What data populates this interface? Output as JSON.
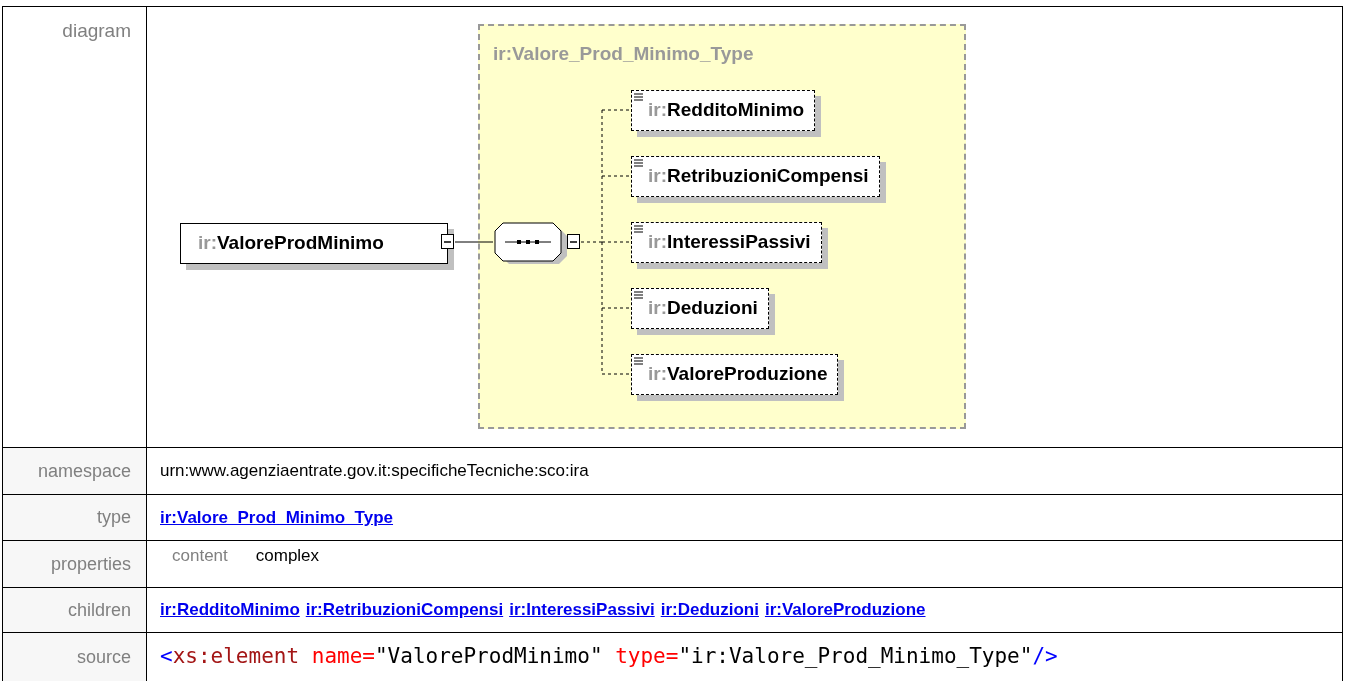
{
  "diagram": {
    "label": "diagram",
    "type_title": "ir:Valore_Prod_Minimo_Type",
    "element": {
      "prefix": "ir:",
      "name": "ValoreProdMinimo"
    },
    "children": [
      {
        "prefix": "ir:",
        "name": "RedditoMinimo"
      },
      {
        "prefix": "ir:",
        "name": "RetribuzioniCompensi"
      },
      {
        "prefix": "ir:",
        "name": "InteressiPassivi"
      },
      {
        "prefix": "ir:",
        "name": "Deduzioni"
      },
      {
        "prefix": "ir:",
        "name": "ValoreProduzione"
      }
    ]
  },
  "rows": [
    {
      "kind": "text",
      "label": "namespace",
      "value": "urn:www.agenziaentrate.gov.it:specificheTecniche:sco:ira"
    },
    {
      "kind": "link",
      "label": "type",
      "value": "ir:Valore_Prod_Minimo_Type"
    },
    {
      "kind": "properties",
      "label": "properties",
      "key": "content",
      "value": "complex"
    },
    {
      "kind": "links",
      "label": "children",
      "links": [
        "ir:RedditoMinimo",
        "ir:RetribuzioniCompensi",
        "ir:InteressiPassivi",
        "ir:Deduzioni",
        "ir:ValoreProduzione"
      ]
    },
    {
      "kind": "code",
      "label": "source",
      "tokens": [
        {
          "text": "<",
          "color": "#0000ff"
        },
        {
          "text": "xs:element",
          "color": "#a31515"
        },
        {
          "text": " name=",
          "color": "#ff0000"
        },
        {
          "text": "\"ValoreProdMinimo\"",
          "color": "#000000"
        },
        {
          "text": " type=",
          "color": "#ff0000"
        },
        {
          "text": "\"ir:Valore_Prod_Minimo_Type\"",
          "color": "#000000"
        },
        {
          "text": "/>",
          "color": "#0000ff"
        }
      ]
    }
  ]
}
